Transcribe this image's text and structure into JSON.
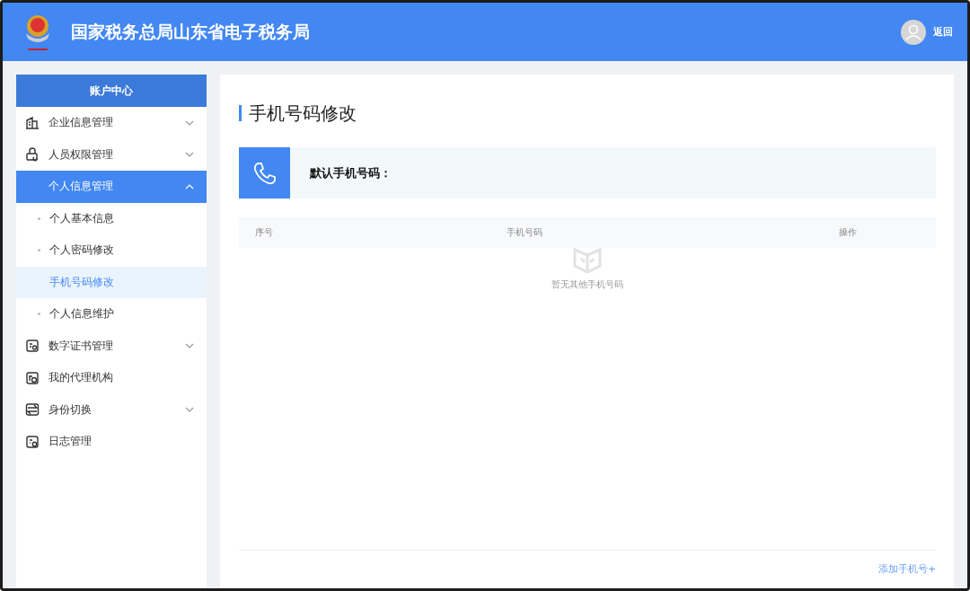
{
  "header": {
    "title": "国家税务总局山东省电子税务局",
    "back": "返回"
  },
  "sidebar": {
    "title": "账户中心",
    "items": [
      {
        "label": "企业信息管理",
        "expanded": false,
        "selected": false
      },
      {
        "label": "人员权限管理",
        "expanded": false,
        "selected": false
      },
      {
        "label": "个人信息管理",
        "expanded": true,
        "selected": true,
        "children": [
          {
            "label": "个人基本信息",
            "selected": false
          },
          {
            "label": "个人密码修改",
            "selected": false
          },
          {
            "label": "手机号码修改",
            "selected": true
          },
          {
            "label": "个人信息维护",
            "selected": false
          }
        ]
      },
      {
        "label": "数字证书管理",
        "expanded": false,
        "selected": false
      },
      {
        "label": "我的代理机构",
        "selected": false
      },
      {
        "label": "身份切换",
        "expanded": false,
        "selected": false
      },
      {
        "label": "日志管理",
        "selected": false
      }
    ]
  },
  "main": {
    "title": "手机号码修改",
    "default_phone_label": "默认手机号码：",
    "table": {
      "columns": [
        "序号",
        "手机号码",
        "操作"
      ],
      "empty_text": "暂无其他手机号码"
    },
    "add_link": "添加手机号+"
  }
}
